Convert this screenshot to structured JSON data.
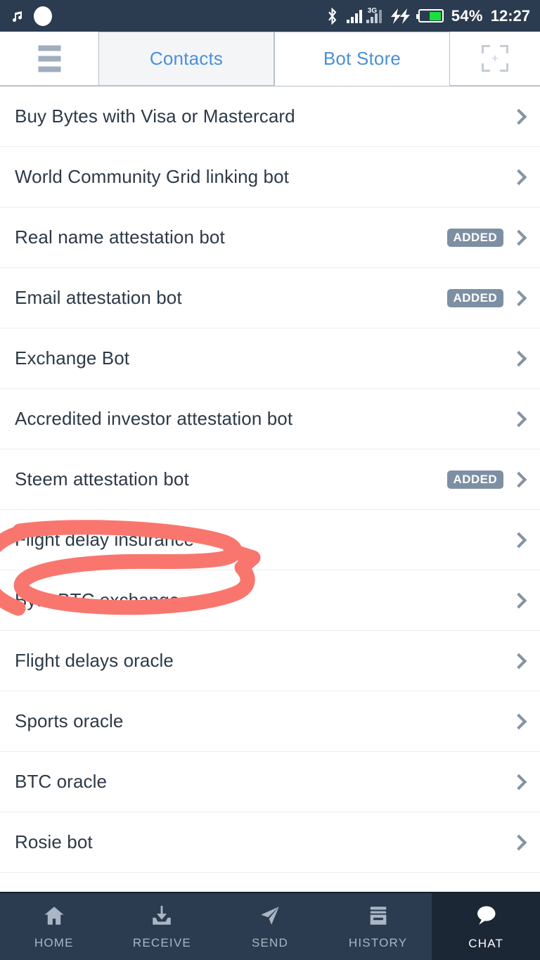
{
  "status_bar": {
    "left_icons": [
      "music-note-icon",
      "white-circle-icon"
    ],
    "right_icons": [
      "bluetooth-icon",
      "signal-bars-icon",
      "network-3g-icon",
      "charging-bolt-icon",
      "battery-icon"
    ],
    "network_type": "3G",
    "battery_percent": "54%",
    "time": "12:27",
    "background_color": "#2b3b50"
  },
  "topbar": {
    "menu_icon": "hamburger-menu-icon",
    "scan_icon": "scan-add-icon",
    "tabs": [
      {
        "label": "Contacts",
        "active": false
      },
      {
        "label": "Bot Store",
        "active": true
      }
    ],
    "tab_text_color": "#4a90d9"
  },
  "bot_list": {
    "badge_text": "ADDED",
    "items": [
      {
        "name": "Buy Bytes with Visa or Mastercard",
        "added": false
      },
      {
        "name": "World Community Grid linking bot",
        "added": false
      },
      {
        "name": "Real name attestation bot",
        "added": true
      },
      {
        "name": "Email attestation bot",
        "added": true
      },
      {
        "name": "Exchange Bot",
        "added": false
      },
      {
        "name": "Accredited investor attestation bot",
        "added": false
      },
      {
        "name": "Steem attestation bot",
        "added": true
      },
      {
        "name": "Flight delay insurance",
        "added": false
      },
      {
        "name": "Byte-BTC exchange",
        "added": false
      },
      {
        "name": "Flight delays oracle",
        "added": false
      },
      {
        "name": "Sports oracle",
        "added": false
      },
      {
        "name": "BTC oracle",
        "added": false
      },
      {
        "name": "Rosie bot",
        "added": false
      }
    ]
  },
  "annotation": {
    "shape": "hand-drawn-oval",
    "color": "#f9766f",
    "targets": "Steem attestation bot"
  },
  "bottom_nav": {
    "items": [
      {
        "label": "HOME",
        "icon": "home-icon",
        "active": false
      },
      {
        "label": "RECEIVE",
        "icon": "download-tray-icon",
        "active": false
      },
      {
        "label": "SEND",
        "icon": "paper-plane-icon",
        "active": false
      },
      {
        "label": "HISTORY",
        "icon": "archive-box-icon",
        "active": false
      },
      {
        "label": "CHAT",
        "icon": "speech-bubble-icon",
        "active": true
      }
    ]
  }
}
